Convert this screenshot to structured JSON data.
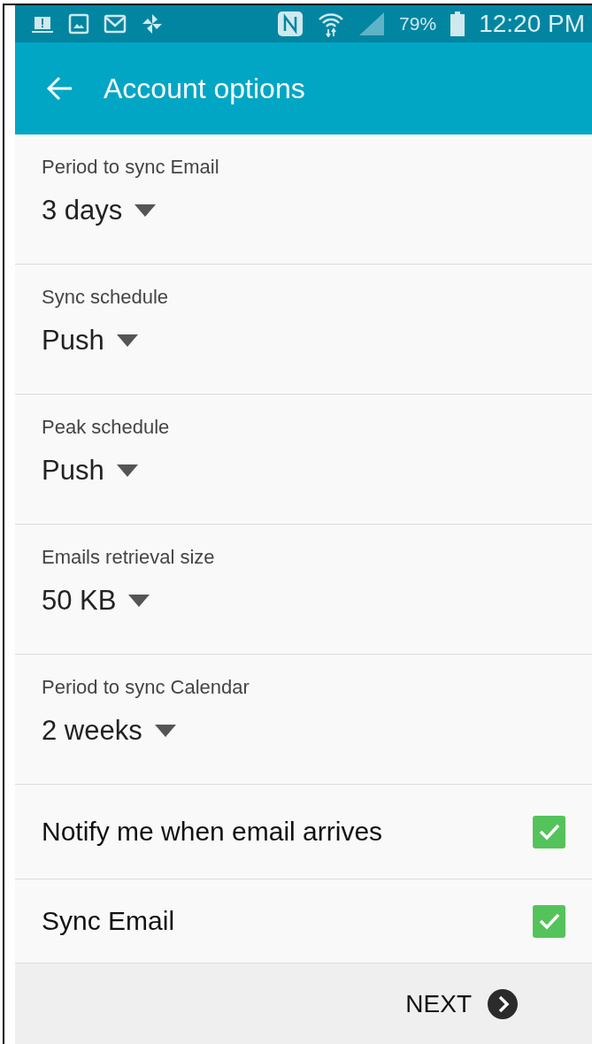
{
  "status_bar": {
    "battery": "79%",
    "time": "12:20 PM"
  },
  "app_bar": {
    "title": "Account options"
  },
  "dropdowns": [
    {
      "label": "Period to sync Email",
      "value": "3 days"
    },
    {
      "label": "Sync schedule",
      "value": "Push"
    },
    {
      "label": "Peak schedule",
      "value": "Push"
    },
    {
      "label": "Emails retrieval size",
      "value": "50 KB"
    },
    {
      "label": "Period to sync Calendar",
      "value": "2 weeks"
    }
  ],
  "checkboxes": [
    {
      "label": "Notify me when email arrives",
      "checked": true
    },
    {
      "label": "Sync Email",
      "checked": true
    }
  ],
  "footer": {
    "button": "NEXT"
  }
}
